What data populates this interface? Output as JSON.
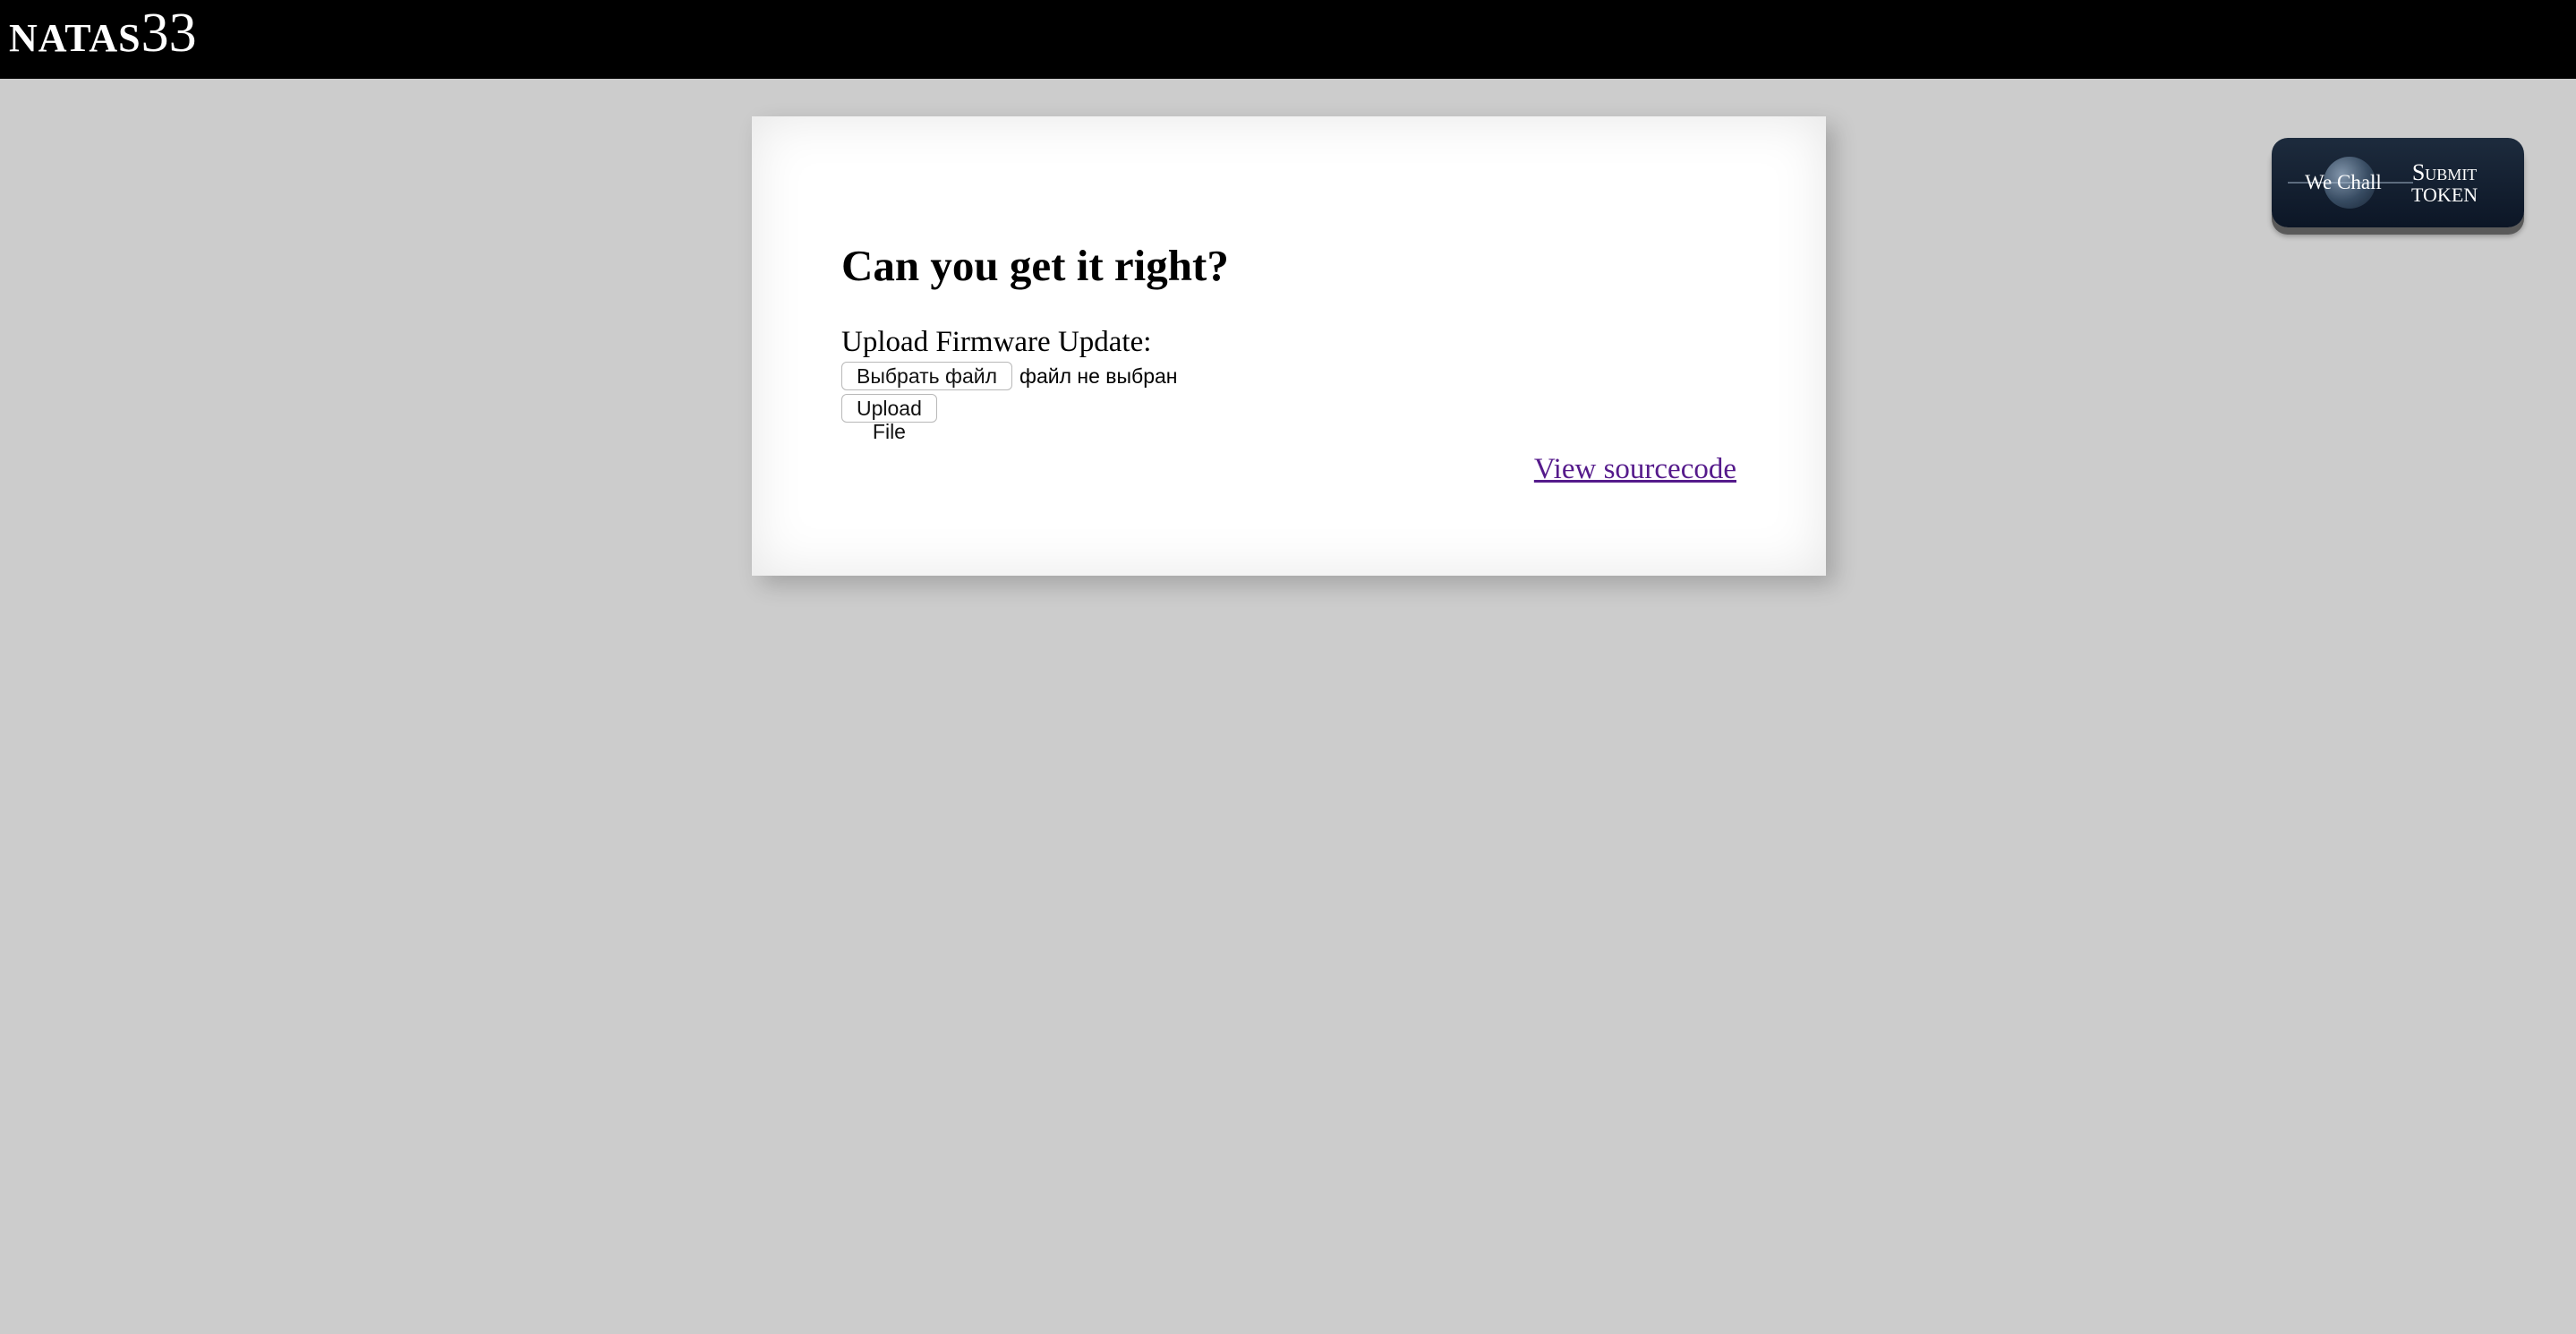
{
  "header": {
    "brand_name": "NATAS",
    "brand_level": "33"
  },
  "content": {
    "title": "Can you get it right?",
    "upload_label": "Upload Firmware Update:",
    "choose_file_label": "Выбрать файл",
    "no_file_text": "файл не выбран",
    "upload_button_label": "Upload File",
    "view_source_label": "View sourcecode"
  },
  "wechall": {
    "logo_text": "We Chall",
    "submit_line1": "Submit",
    "submit_line2": "TOKEN"
  },
  "colors": {
    "topbar": "#000000",
    "background": "#cccccc",
    "card": "#ffffff",
    "link_visited": "#551a8b"
  }
}
